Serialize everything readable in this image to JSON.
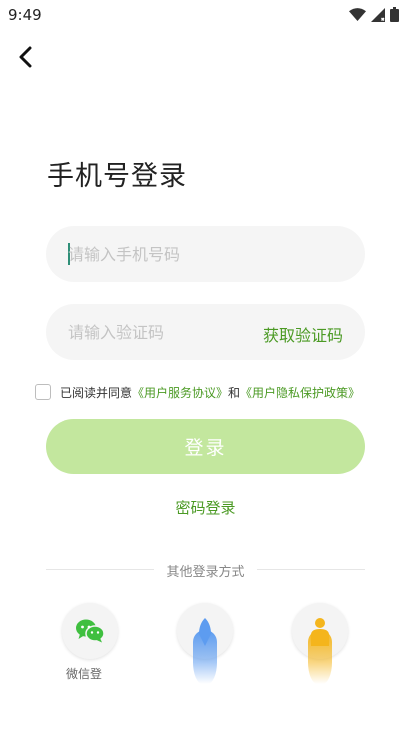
{
  "status_bar": {
    "time": "9:49",
    "icons": [
      "wifi-icon",
      "signal-icon",
      "battery-icon"
    ]
  },
  "header": {
    "back_icon": "chevron-left-icon",
    "title": "手机号登录"
  },
  "form": {
    "phone_placeholder": "请输入手机号码",
    "code_placeholder": "请输入验证码",
    "get_code_label": "获取验证码"
  },
  "agreement": {
    "prefix": "已阅读并同意",
    "user_agreement": "《用户服务协议》",
    "conjunction": "和",
    "privacy_policy": "《用户隐私保护政策》",
    "checked": false
  },
  "login_button": "登录",
  "password_login": "密码登录",
  "other_methods": {
    "label": "其他登录方式",
    "wechat_label": "微信登"
  },
  "colors": {
    "accent": "#4b9a24",
    "button_disabled": "#c3e79e",
    "wechat_green": "#3fbf3f",
    "blue": "#5d9cf0",
    "orange": "#f4b51c"
  }
}
